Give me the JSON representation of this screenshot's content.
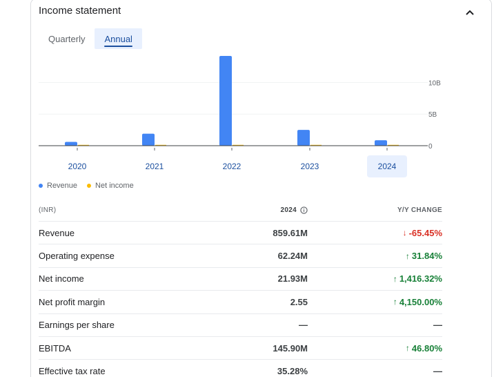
{
  "card": {
    "title": "Income statement"
  },
  "tabs": [
    {
      "label": "Quarterly",
      "active": false
    },
    {
      "label": "Annual",
      "active": true
    }
  ],
  "chart_data": {
    "type": "bar",
    "categories": [
      "2020",
      "2021",
      "2022",
      "2023",
      "2024"
    ],
    "selected_category": "2024",
    "series": [
      {
        "name": "Revenue",
        "color": "#4285f4",
        "values": [
          0.6,
          1.9,
          14.2,
          2.5,
          0.86
        ]
      },
      {
        "name": "Net income",
        "color": "#fbbc04",
        "values": [
          0.05,
          0.05,
          0.05,
          0.05,
          0.02
        ]
      }
    ],
    "y_ticks": [
      {
        "value": 10,
        "label": "10B"
      },
      {
        "value": 5,
        "label": "5B"
      },
      {
        "value": 0,
        "label": "0"
      }
    ],
    "ylim": [
      0,
      14.2
    ],
    "grid": true,
    "legend_position": "bottom-left"
  },
  "table": {
    "headers": {
      "label": "(INR)",
      "value": "2024",
      "change": "Y/Y CHANGE"
    },
    "rows": [
      {
        "label": "Revenue",
        "value": "859.61M",
        "change": "-65.45%",
        "direction": "down"
      },
      {
        "label": "Operating expense",
        "value": "62.24M",
        "change": "31.84%",
        "direction": "up"
      },
      {
        "label": "Net income",
        "value": "21.93M",
        "change": "1,416.32%",
        "direction": "up"
      },
      {
        "label": "Net profit margin",
        "value": "2.55",
        "change": "4,150.00%",
        "direction": "up"
      },
      {
        "label": "Earnings per share",
        "value": "—",
        "change": "—",
        "direction": "none"
      },
      {
        "label": "EBITDA",
        "value": "145.90M",
        "change": "46.80%",
        "direction": "up"
      },
      {
        "label": "Effective tax rate",
        "value": "35.28%",
        "change": "—",
        "direction": "none"
      }
    ]
  }
}
